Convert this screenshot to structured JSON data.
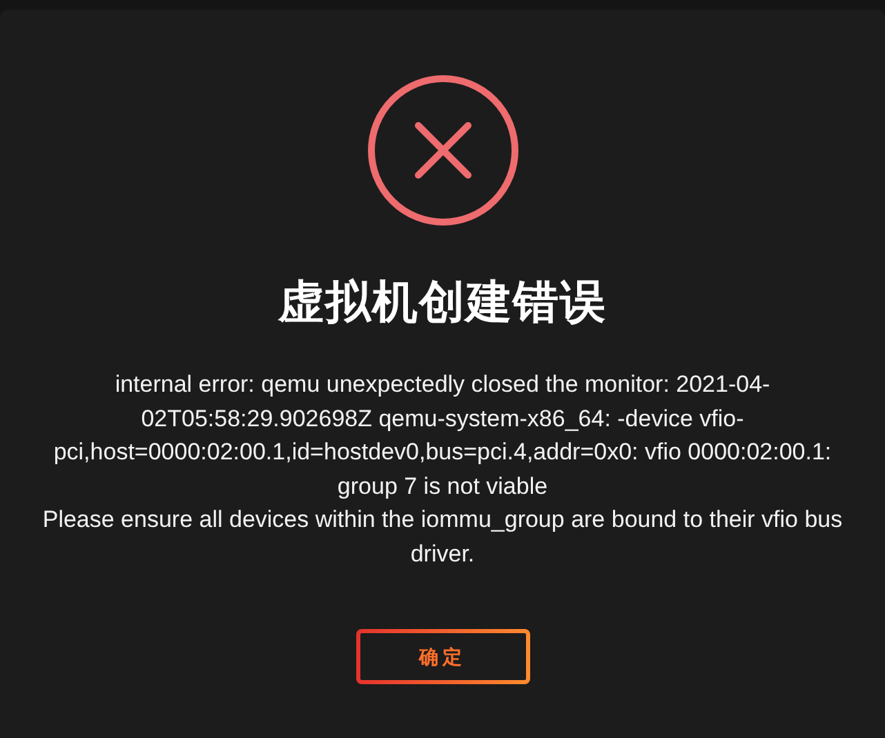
{
  "dialog": {
    "title": "虚拟机创建错误",
    "message": [
      "internal error: qemu unexpectedly closed the monitor: 2021-04-02T05:58:29.902698Z qemu-system-x86_64: -device vfio-pci,host=0000:02:00.1,id=hostdev0,bus=pci.4,addr=0x0: vfio 0000:02:00.1: group 7 is not viable",
      "Please ensure all devices within the iommu_group are bound to their vfio bus driver."
    ],
    "buttons": [
      "确定"
    ]
  }
}
